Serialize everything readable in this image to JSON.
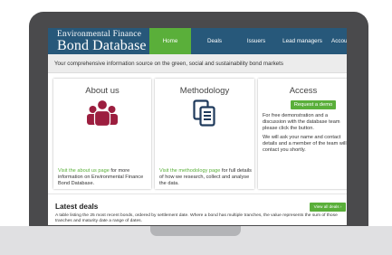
{
  "header": {
    "logo_line1": "Environmental Finance",
    "logo_line2": "Bond Database"
  },
  "nav": {
    "home": "Home",
    "deals": "Deals",
    "issuers": "Issuers",
    "lead_managers": "Lead managers",
    "account": "Account ≡"
  },
  "tagline": "Your comprehensive information source on the green, social and sustainability bond markets",
  "about": {
    "title": "About us",
    "link": "Visit the about us page",
    "text": " for more information on Environmental Finance Bond Database."
  },
  "methodology": {
    "title": "Methodology",
    "link": "Visit the methodology page",
    "text": " for full details of how we research, collect and analyse the data."
  },
  "access": {
    "title": "Access",
    "button": "Request a demo",
    "text1": "For free demonstration and a discussion with the database team please click the button.",
    "text2": "We will ask your name and contact details and a member of the team will contact you shortly."
  },
  "latest": {
    "title": "Latest deals",
    "view_all": "View all deals ›",
    "description": "A table listing the 25 most recent bonds, ordered by settlement date. Where a bond has multiple tranches, the value represents the sum of those tranches and maturity date a range of dates."
  },
  "colors": {
    "header_bg": "#27587a",
    "accent_green": "#5aaf3a",
    "about_icon": "#9c1e3f",
    "methodology_icon": "#1f3a5c"
  },
  "icons": {
    "about": "users-group-icon",
    "methodology": "documents-icon"
  }
}
